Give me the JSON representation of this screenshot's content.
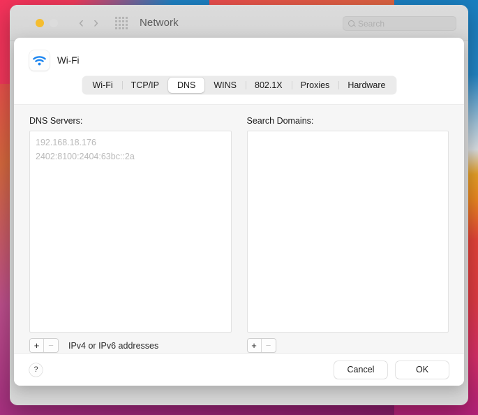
{
  "window": {
    "title": "Network",
    "traffic_lights": [
      "close",
      "minimize",
      "zoom"
    ],
    "nav_back": "‹",
    "nav_forward": "›",
    "grid_icon": "grid-icon"
  },
  "search": {
    "placeholder": "Search",
    "icon": "search-icon"
  },
  "sheet": {
    "service_name": "Wi-Fi",
    "service_icon": "wifi-icon",
    "tabs": [
      {
        "label": "Wi-Fi",
        "active": false
      },
      {
        "label": "TCP/IP",
        "active": false
      },
      {
        "label": "DNS",
        "active": true
      },
      {
        "label": "WINS",
        "active": false
      },
      {
        "label": "802.1X",
        "active": false
      },
      {
        "label": "Proxies",
        "active": false
      },
      {
        "label": "Hardware",
        "active": false
      }
    ],
    "dns": {
      "label": "DNS Servers:",
      "entries": [
        "192.168.18.176",
        "2402:8100:2404:63bc::2a"
      ],
      "add_label": "+",
      "remove_label": "−",
      "hint": "IPv4 or IPv6 addresses"
    },
    "search_domains": {
      "label": "Search Domains:",
      "entries": [],
      "add_label": "+",
      "remove_label": "−"
    },
    "footer": {
      "help_label": "?",
      "cancel_label": "Cancel",
      "ok_label": "OK"
    }
  },
  "colors": {
    "wifi_blue": "#1a84f0",
    "minimize_yellow": "#f5bd2f",
    "active_tab_bg": "#ffffff",
    "placeholder_text": "#b9b9b9"
  }
}
